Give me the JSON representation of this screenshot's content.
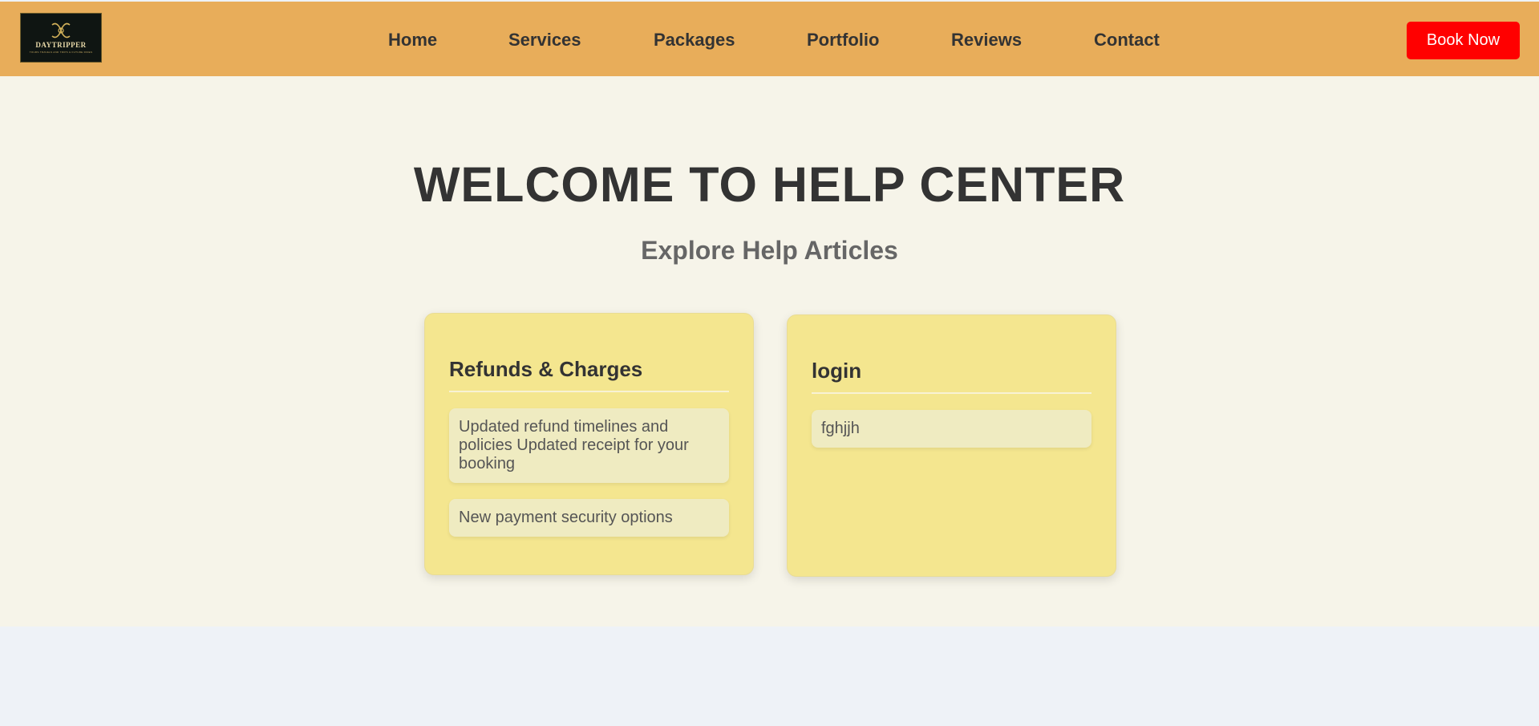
{
  "header": {
    "logo": {
      "brand": "DAYTRIPPER",
      "tagline": "TOURS TRAVELS AND TRIPS & FUTURE RIDES"
    },
    "nav": [
      {
        "label": "Home"
      },
      {
        "label": "Services"
      },
      {
        "label": "Packages"
      },
      {
        "label": "Portfolio"
      },
      {
        "label": "Reviews"
      },
      {
        "label": "Contact"
      }
    ],
    "book_label": "Book Now"
  },
  "main": {
    "title": "WELCOME TO HELP CENTER",
    "subtitle": "Explore Help Articles",
    "cards": [
      {
        "title": "Refunds & Charges",
        "articles": [
          "Updated refund timelines and policies Updated receipt for your booking",
          "New payment security options"
        ]
      },
      {
        "title": "login",
        "articles": [
          "fghjjh"
        ]
      }
    ]
  },
  "colors": {
    "header_bg": "#e8ad5a",
    "book_button": "#ff0000",
    "page_bg": "#f6f4e9",
    "card_bg": "#f4e68f",
    "article_bg": "#efebc1",
    "footer_bg": "#eef2f7"
  },
  "icons": {
    "logo_mark": "daytripper-emblem-icon"
  }
}
